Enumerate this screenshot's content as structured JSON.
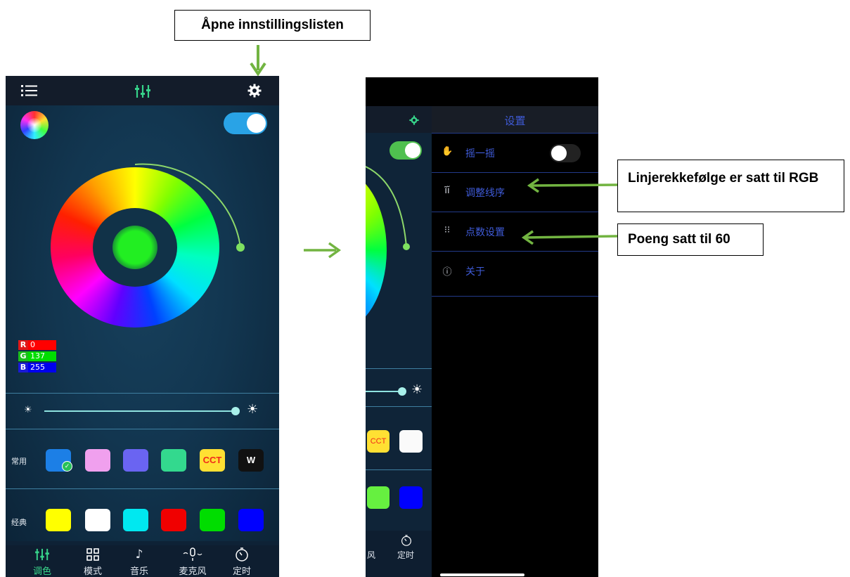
{
  "annotations": {
    "open_settings": "Åpne innstillingslisten",
    "line_order": "Linjerekkefølge er satt til RGB",
    "points": "Poeng satt til 60"
  },
  "colors": {
    "arrow": "#72b441",
    "menu_text": "#3f5bd8",
    "toggle_on": "#29a3e6",
    "toggle_on_green": "#4fc04f"
  },
  "left_phone": {
    "topbar": {
      "menu_icon": "list-icon",
      "mixer_icon": "sliders-icon",
      "settings_icon": "gear-icon"
    },
    "rgb": {
      "r_label": "R",
      "r_value": "0",
      "g_label": "G",
      "g_value": "137",
      "b_label": "B",
      "b_value": "255"
    },
    "brightness": {
      "level": 0.98
    },
    "common": {
      "label": "常用",
      "swatches": [
        "#1c7fe6",
        "#f0a0ee",
        "#6a64f2",
        "#33d98e",
        "CCT",
        "W"
      ],
      "cct_label": "CCT",
      "w_label": "W"
    },
    "classic": {
      "label": "经典",
      "swatches": [
        "#ffff00",
        "#ffffff",
        "#00e8f0",
        "#f00000",
        "#00dd00",
        "#0000ff"
      ]
    },
    "nav": [
      {
        "label": "调色",
        "icon": "sliders-icon"
      },
      {
        "label": "模式",
        "icon": "grid-icon"
      },
      {
        "label": "音乐",
        "icon": "music-note-icon"
      },
      {
        "label": "麦克风",
        "icon": "microphone-icon"
      },
      {
        "label": "定时",
        "icon": "timer-icon"
      }
    ]
  },
  "right_phone": {
    "panel_title": "设置",
    "menu": [
      {
        "label": "摇一摇",
        "icon": "shake-icon"
      },
      {
        "label": "调整线序",
        "icon": "wire-order-icon"
      },
      {
        "label": "点数设置",
        "icon": "dots-icon"
      },
      {
        "label": "关于",
        "icon": "info-icon"
      }
    ],
    "cct_label": "CCT",
    "nav_partial": [
      {
        "label": "风"
      },
      {
        "label": "定时"
      }
    ]
  }
}
